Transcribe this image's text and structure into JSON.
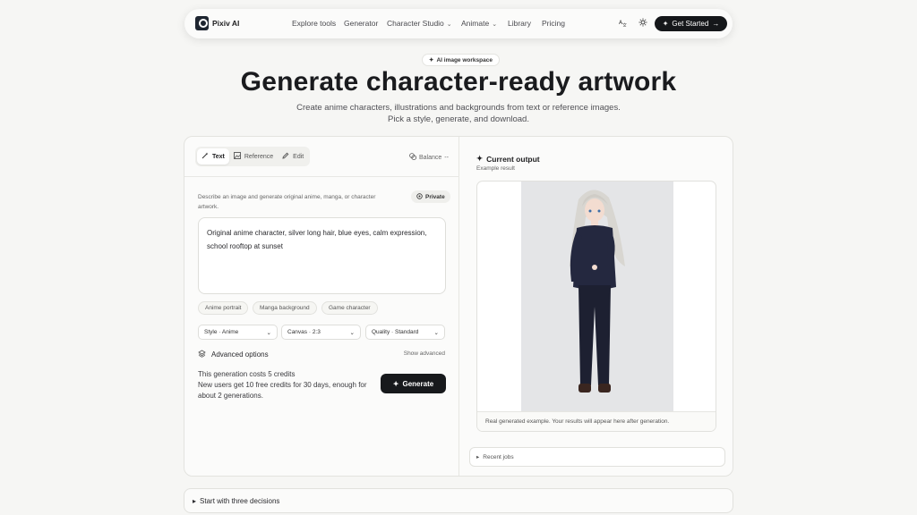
{
  "nav": {
    "brand": "Pixiv AI",
    "items": [
      {
        "label": "Explore tools"
      },
      {
        "label": "Generator"
      },
      {
        "label": "Character Studio"
      },
      {
        "label": "Animate"
      },
      {
        "label": "Library"
      },
      {
        "label": "Pricing"
      }
    ],
    "cta": "Get Started"
  },
  "hero": {
    "badge": "AI image workspace",
    "title": "Generate character-ready artwork",
    "subtitle_line1": "Create anime characters, illustrations and backgrounds from text or reference images.",
    "subtitle_line2": "Pick a style, generate, and download."
  },
  "editor": {
    "tabs": [
      {
        "label": "Text"
      },
      {
        "label": "Reference"
      },
      {
        "label": "Edit"
      }
    ],
    "balance_label": "Balance",
    "balance_value": "--",
    "description": "Describe an image and generate original anime, manga, or character artwork.",
    "private_label": "Private",
    "prompt": "Original anime character, silver long hair, blue eyes, calm expression, school rooftop at sunset",
    "chips": [
      {
        "label": "Anime portrait"
      },
      {
        "label": "Manga background"
      },
      {
        "label": "Game character"
      }
    ],
    "selects": [
      {
        "value": "Style · Anime"
      },
      {
        "value": "Canvas · 2:3"
      },
      {
        "value": "Quality · Standard"
      }
    ],
    "advanced_title": "Advanced options",
    "advanced_toggle": "Show advanced",
    "cost_line1": "This generation costs 5 credits",
    "cost_line2": "New users get 10 free credits for 30 days, enough for about 2 generations.",
    "generate_label": "Generate"
  },
  "output": {
    "title": "Current output",
    "subtitle": "Example result",
    "caption": "Real generated example. Your results will appear here after generation.",
    "recent_label": "Recent jobs"
  },
  "footer_section": {
    "label": "Start with three decisions"
  }
}
